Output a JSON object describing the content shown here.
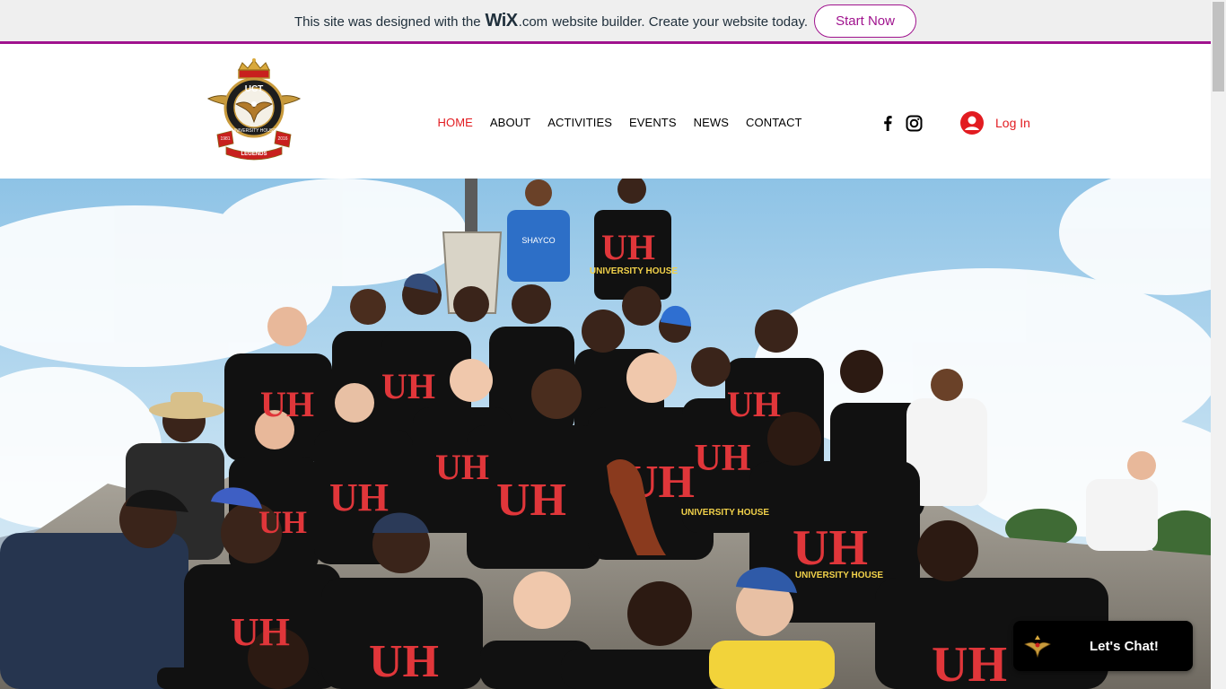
{
  "banner": {
    "text_before": "This site was designed with the",
    "wix_logo": "WiX",
    "wix_com": ".com",
    "text_after": "website builder. Create your website today.",
    "cta_label": "Start Now",
    "accent_color": "#a0138e"
  },
  "header": {
    "logo": {
      "top_text": "UCT",
      "ring_text": "UNIVERSITY HOUSE",
      "ribbon_text": "LEGENDS",
      "year_left": "1981",
      "year_right": "2016"
    },
    "nav": [
      {
        "label": "HOME",
        "active": true
      },
      {
        "label": "ABOUT",
        "active": false
      },
      {
        "label": "ACTIVITIES",
        "active": false
      },
      {
        "label": "EVENTS",
        "active": false
      },
      {
        "label": "NEWS",
        "active": false
      },
      {
        "label": "CONTACT",
        "active": false
      }
    ],
    "social": [
      {
        "icon": "facebook-icon"
      },
      {
        "icon": "instagram-icon"
      }
    ],
    "login_label": "Log In",
    "accent_color": "#e21c21"
  },
  "hero": {
    "description_icon": "group-photo-image",
    "shirt_text": "UNIVERSITY HOUSE",
    "shirt_text_short": "UH",
    "sign_text": "SHAYCO"
  },
  "chat": {
    "label": "Let's Chat!"
  }
}
